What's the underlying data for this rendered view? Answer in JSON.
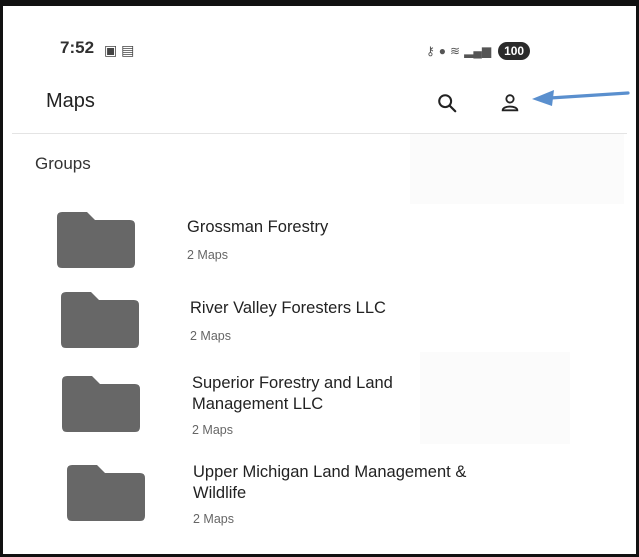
{
  "status_bar": {
    "time": "7:52",
    "left_icons": [
      "notification-icon",
      "teams-icon"
    ],
    "right_icons": [
      "key-icon",
      "location-icon",
      "wifi-icon",
      "signal-icon"
    ],
    "battery": "100"
  },
  "app_bar": {
    "title": "Maps",
    "actions": [
      "search-icon",
      "account-icon"
    ]
  },
  "annotation": {
    "arrow_color": "#5a8fce",
    "points_to": "account-icon"
  },
  "groups": {
    "title": "Groups",
    "items": [
      {
        "name": "Grossman Forestry",
        "count": "2 Maps"
      },
      {
        "name": "River Valley Foresters LLC",
        "count": "2 Maps"
      },
      {
        "name": "Superior Forestry and Land Management LLC",
        "count": "2 Maps"
      },
      {
        "name": "Upper Michigan Land Management & Wildlife",
        "count": "2 Maps"
      }
    ]
  },
  "colors": {
    "folder": "#676767",
    "frame": "#111111",
    "accent_arrow": "#5a8fce"
  }
}
